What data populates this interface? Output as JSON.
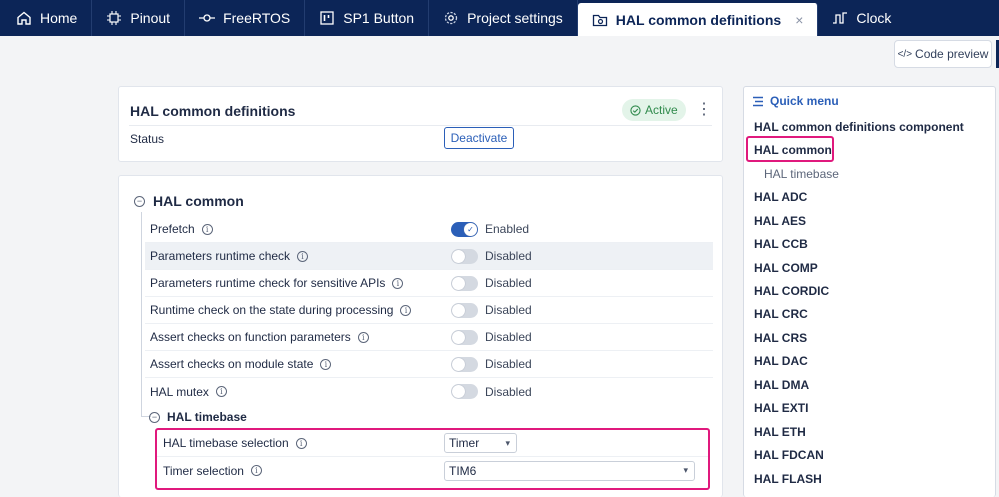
{
  "tabs": [
    {
      "label": "Home",
      "icon": "home-icon"
    },
    {
      "label": "Pinout",
      "icon": "chip-icon"
    },
    {
      "label": "FreeRTOS",
      "icon": "commit-icon"
    },
    {
      "label": "SP1 Button",
      "icon": "board-icon"
    },
    {
      "label": "Project settings",
      "icon": "gear-icon"
    },
    {
      "label": "HAL common definitions",
      "icon": "folder-gear-icon",
      "close": "×"
    },
    {
      "label": "Clock",
      "icon": "clock-wave-icon"
    }
  ],
  "toolbar": {
    "code_preview_label": "Code preview",
    "code_preview_icon": "</>"
  },
  "component": {
    "title": "HAL common definitions",
    "status_badge": "Active",
    "status_label": "Status",
    "deactivate_label": "Deactivate",
    "menu_glyph": "⋮"
  },
  "hal_common": {
    "title": "HAL common",
    "rows": [
      {
        "label": "Prefetch",
        "state": "Enabled",
        "on": true
      },
      {
        "label": "Parameters runtime check",
        "state": "Disabled",
        "on": false
      },
      {
        "label": "Parameters runtime check for sensitive APIs",
        "state": "Disabled",
        "on": false
      },
      {
        "label": "Runtime check on the state during processing",
        "state": "Disabled",
        "on": false
      },
      {
        "label": "Assert checks on function parameters",
        "state": "Disabled",
        "on": false
      },
      {
        "label": "Assert checks on module state",
        "state": "Disabled",
        "on": false
      },
      {
        "label": "HAL mutex",
        "state": "Disabled",
        "on": false
      }
    ],
    "timebase": {
      "title": "HAL timebase",
      "selection_label": "HAL timebase selection",
      "selection_value": "Timer",
      "timer_label": "Timer selection",
      "timer_value": "TIM6"
    }
  },
  "quick_menu": {
    "title": "Quick menu",
    "items": [
      {
        "label": "HAL common definitions component",
        "sub": false
      },
      {
        "label": "HAL common",
        "sub": false
      },
      {
        "label": "HAL timebase",
        "sub": true
      },
      {
        "label": "HAL ADC",
        "sub": false
      },
      {
        "label": "HAL AES",
        "sub": false
      },
      {
        "label": "HAL CCB",
        "sub": false
      },
      {
        "label": "HAL COMP",
        "sub": false
      },
      {
        "label": "HAL CORDIC",
        "sub": false
      },
      {
        "label": "HAL CRC",
        "sub": false
      },
      {
        "label": "HAL CRS",
        "sub": false
      },
      {
        "label": "HAL DAC",
        "sub": false
      },
      {
        "label": "HAL DMA",
        "sub": false
      },
      {
        "label": "HAL EXTI",
        "sub": false
      },
      {
        "label": "HAL ETH",
        "sub": false
      },
      {
        "label": "HAL FDCAN",
        "sub": false
      },
      {
        "label": "HAL FLASH",
        "sub": false
      }
    ]
  },
  "colors": {
    "tabbar": "#0c2557",
    "accent": "#2b5fb8",
    "highlight": "#e0197d",
    "active_badge": "#2f8a4c"
  }
}
